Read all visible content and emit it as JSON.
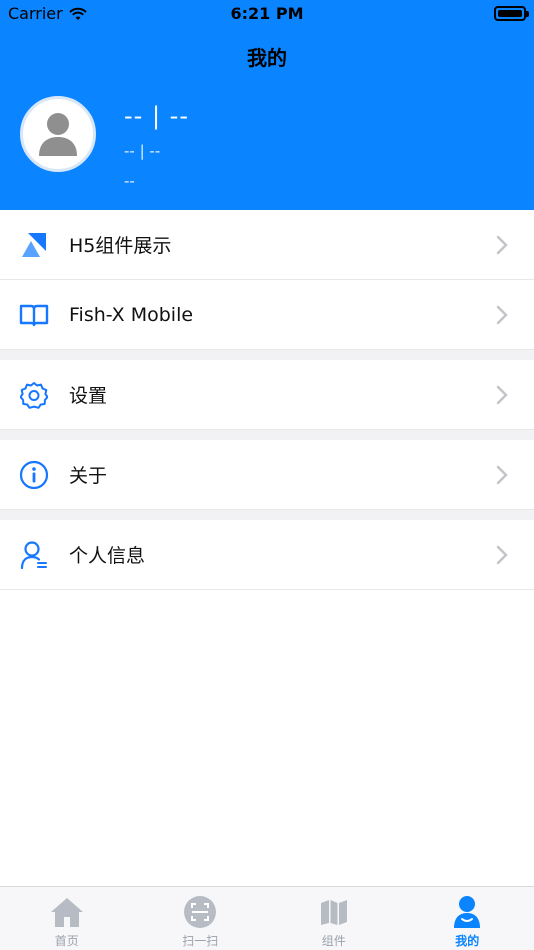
{
  "status_bar": {
    "carrier": "Carrier",
    "time": "6:21 PM"
  },
  "header": {
    "title": "我的"
  },
  "profile": {
    "name": "-- | --",
    "line1": "-- | --",
    "line2": "--"
  },
  "menu": [
    {
      "label": "H5组件展示",
      "icon": "h5-components-icon"
    },
    {
      "label": "Fish-X Mobile",
      "icon": "book-icon"
    },
    {
      "label": "设置",
      "icon": "gear-icon"
    },
    {
      "label": "关于",
      "icon": "info-icon"
    },
    {
      "label": "个人信息",
      "icon": "user-profile-icon"
    }
  ],
  "tabs": [
    {
      "label": "首页",
      "icon": "home-icon"
    },
    {
      "label": "扫一扫",
      "icon": "scan-icon"
    },
    {
      "label": "组件",
      "icon": "map-icon"
    },
    {
      "label": "我的",
      "icon": "user-icon",
      "active": true
    }
  ],
  "colors": {
    "accent": "#0a84ff",
    "inactive": "#9aa2ad"
  }
}
